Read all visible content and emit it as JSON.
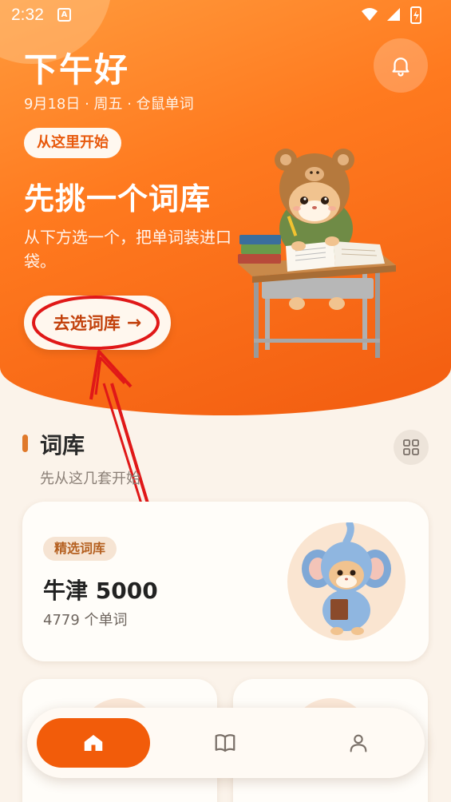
{
  "status": {
    "time": "2:32",
    "notification_icon": "a-badge-icon"
  },
  "header": {
    "greeting": "下午好",
    "subinfo": "9月18日 · 周五 · 仓鼠单词"
  },
  "hero": {
    "chip": "从这里开始",
    "title": "先挑一个词库",
    "description": "从下方选一个，把单词装进口袋。",
    "cta_label": "去选词库",
    "cta_arrow": "→"
  },
  "section": {
    "title": "词库",
    "subtitle": "先从这几套开始"
  },
  "featured": {
    "badge": "精选词库",
    "title": "牛津 5000",
    "count": "4779 个单词"
  },
  "nav": {
    "items": [
      "home-icon",
      "book-icon",
      "person-icon"
    ],
    "active": 0
  },
  "colors": {
    "accent": "#f25c0a",
    "hero_start": "#ff9a3c",
    "annotation": "#e01818"
  }
}
